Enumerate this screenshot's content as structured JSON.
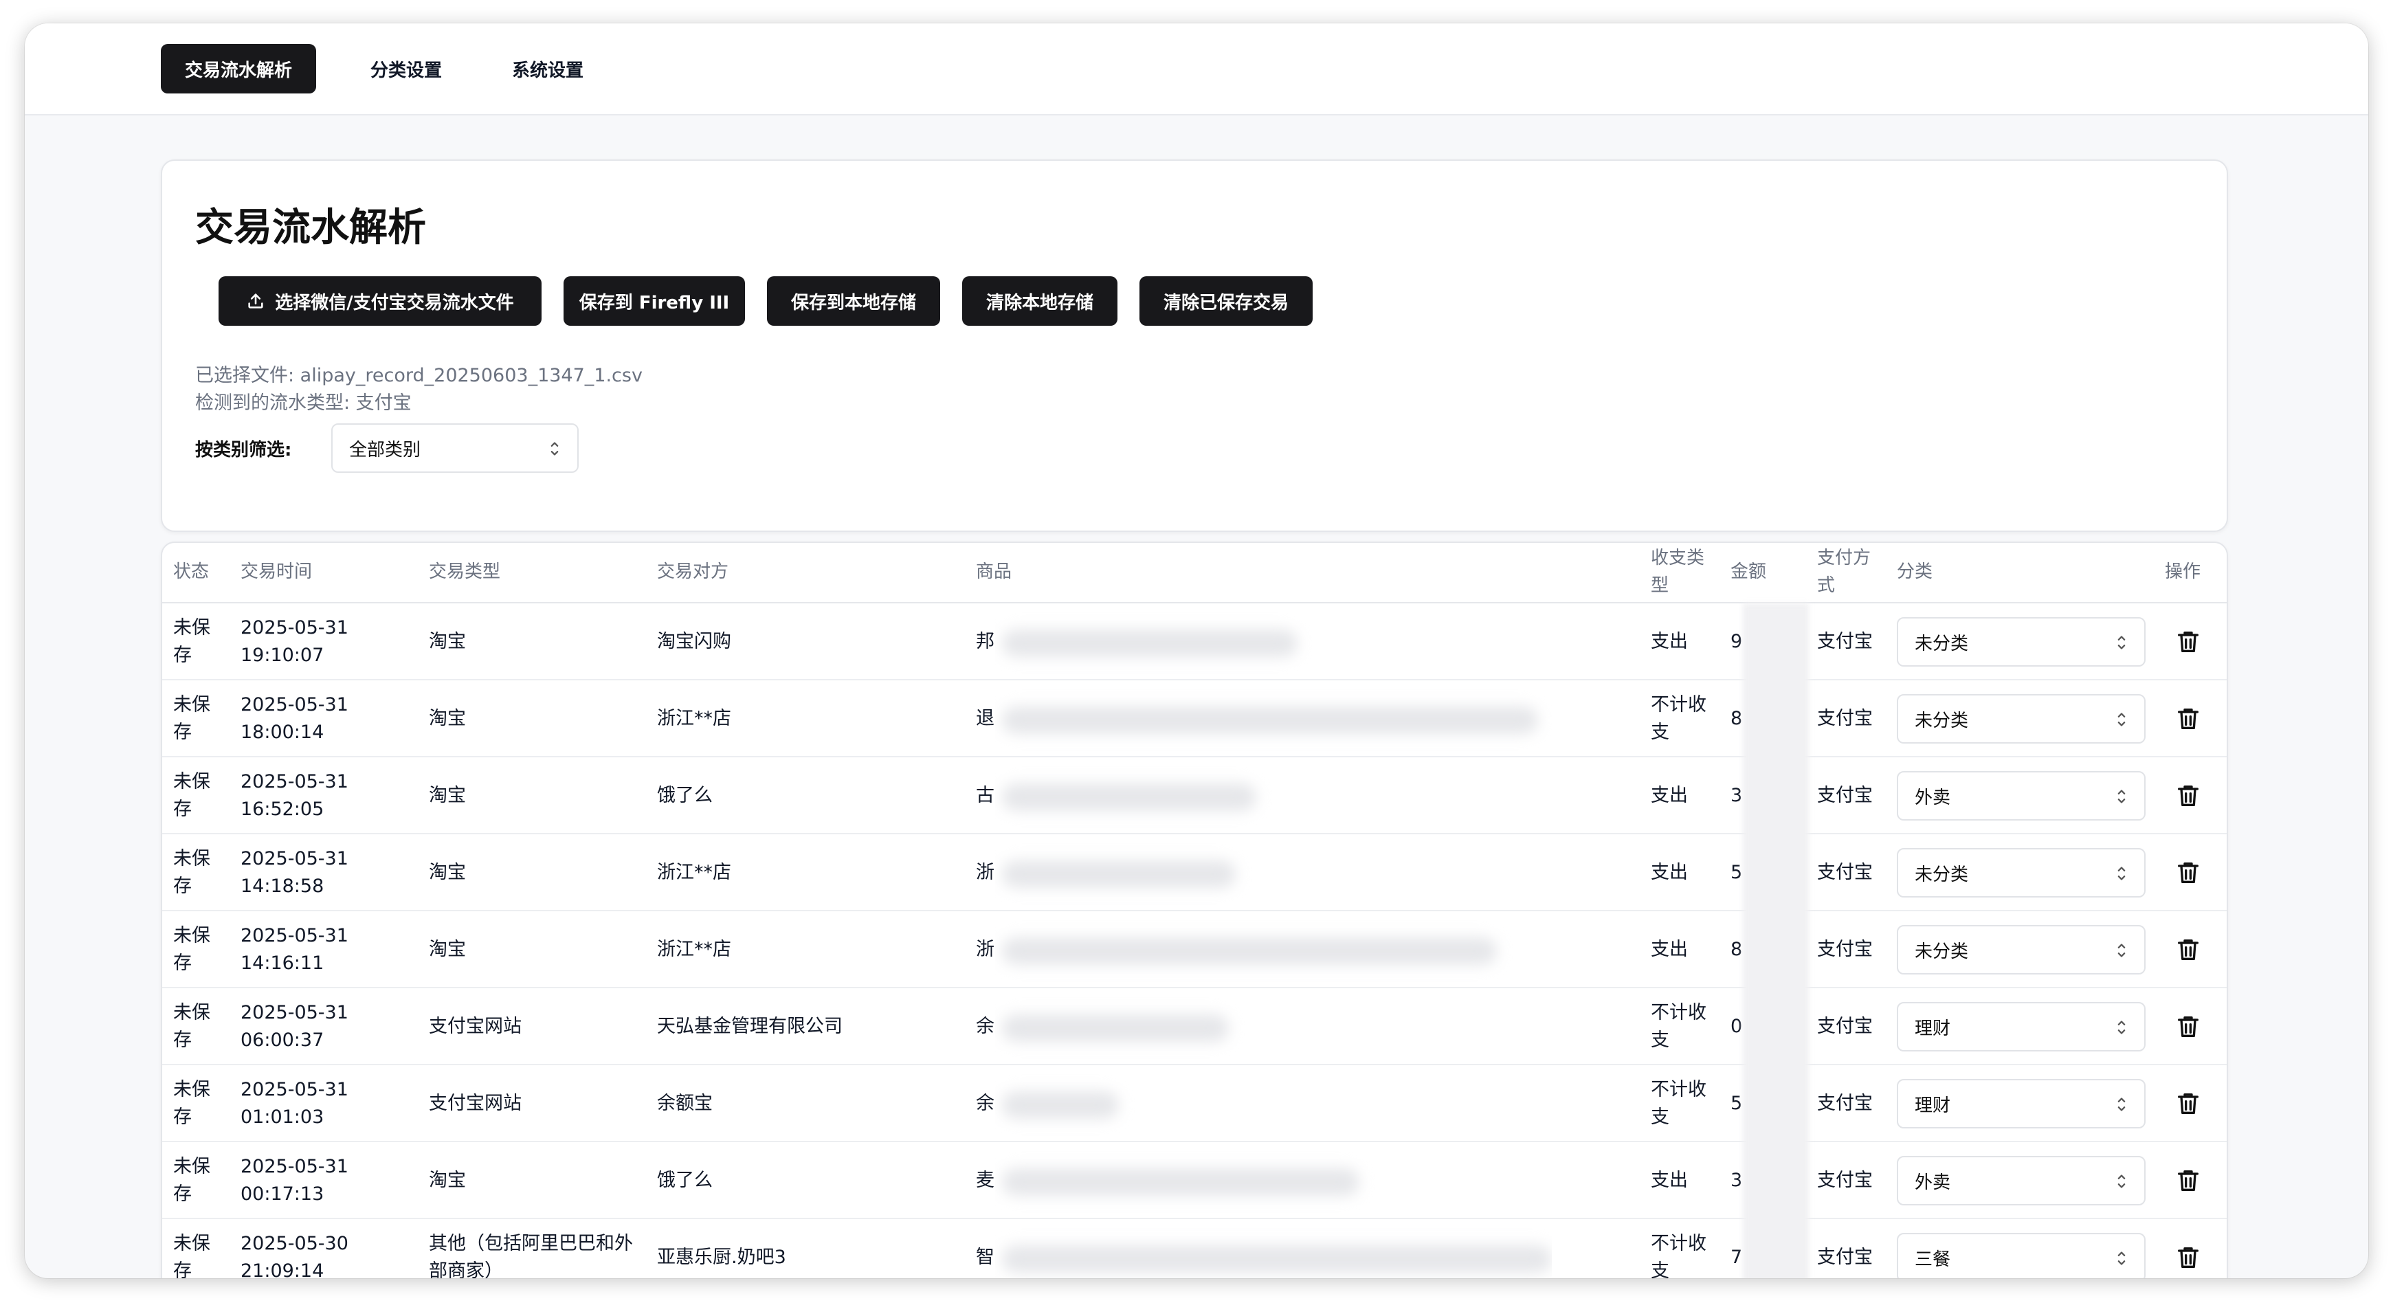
{
  "nav": {
    "tabs": [
      {
        "label": "交易流水解析",
        "active": true
      },
      {
        "label": "分类设置",
        "active": false
      },
      {
        "label": "系统设置",
        "active": false
      }
    ]
  },
  "panel": {
    "title": "交易流水解析",
    "buttons": {
      "select_file": "选择微信/支付宝交易流水文件",
      "save_firefly": "保存到 Firefly III",
      "save_local": "保存到本地存储",
      "clear_local": "清除本地存储",
      "clear_saved": "清除已保存交易"
    },
    "selected_file": "已选择文件: alipay_record_20250603_1347_1.csv",
    "detected_type": "检测到的流水类型: 支付宝",
    "filter_label": "按类别筛选:",
    "filter_value": "全部类别"
  },
  "table": {
    "headers": {
      "status": "状态",
      "time": "交易时间",
      "type": "交易类型",
      "counterparty": "交易对方",
      "goods": "商品",
      "direction": "收支类型",
      "amount": "金额",
      "payment": "支付方式",
      "category": "分类",
      "ops": "操作"
    },
    "rows": [
      {
        "status": "未保存",
        "date": "2025-05-31",
        "time": "19:10:07",
        "type": "淘宝",
        "counterparty": "淘宝闪购",
        "goods": "邦",
        "direction": "支出",
        "amount": "9",
        "payment": "支付宝",
        "category": "未分类"
      },
      {
        "status": "未保存",
        "date": "2025-05-31",
        "time": "18:00:14",
        "type": "淘宝",
        "counterparty": "浙江**店",
        "goods": "退",
        "direction": "不计收支",
        "amount": "8",
        "payment": "支付宝",
        "category": "未分类"
      },
      {
        "status": "未保存",
        "date": "2025-05-31",
        "time": "16:52:05",
        "type": "淘宝",
        "counterparty": "饿了么",
        "goods": "古",
        "direction": "支出",
        "amount": "3",
        "payment": "支付宝",
        "category": "外卖"
      },
      {
        "status": "未保存",
        "date": "2025-05-31",
        "time": "14:18:58",
        "type": "淘宝",
        "counterparty": "浙江**店",
        "goods": "浙",
        "direction": "支出",
        "amount": "5",
        "payment": "支付宝",
        "category": "未分类"
      },
      {
        "status": "未保存",
        "date": "2025-05-31",
        "time": "14:16:11",
        "type": "淘宝",
        "counterparty": "浙江**店",
        "goods": "浙",
        "direction": "支出",
        "amount": "8",
        "payment": "支付宝",
        "category": "未分类"
      },
      {
        "status": "未保存",
        "date": "2025-05-31",
        "time": "06:00:37",
        "type": "支付宝网站",
        "counterparty": "天弘基金管理有限公司",
        "goods": "余",
        "direction": "不计收支",
        "amount": "0",
        "payment": "支付宝",
        "category": "理财"
      },
      {
        "status": "未保存",
        "date": "2025-05-31",
        "time": "01:01:03",
        "type": "支付宝网站",
        "counterparty": "余额宝",
        "goods": "余",
        "direction": "不计收支",
        "amount": "5",
        "payment": "支付宝",
        "category": "理财"
      },
      {
        "status": "未保存",
        "date": "2025-05-31",
        "time": "00:17:13",
        "type": "淘宝",
        "counterparty": "饿了么",
        "goods": "麦",
        "direction": "支出",
        "amount": "3",
        "payment": "支付宝",
        "category": "外卖"
      },
      {
        "status": "未保存",
        "date": "2025-05-30",
        "time": "21:09:14",
        "type": "其他（包括阿里巴巴和外部商家）",
        "counterparty": "亚惠乐厨.奶吧3",
        "goods": "智",
        "direction": "不计收支",
        "amount": "7",
        "payment": "支付宝",
        "category": "三餐"
      }
    ]
  },
  "icons": {
    "upload": "upload-icon",
    "chevron": "chevron-updown-icon",
    "delete": "trash-icon"
  },
  "colors": {
    "primary_button": "#18181b",
    "page_bg": "#f7f8fa",
    "muted_text": "#6b7280"
  }
}
